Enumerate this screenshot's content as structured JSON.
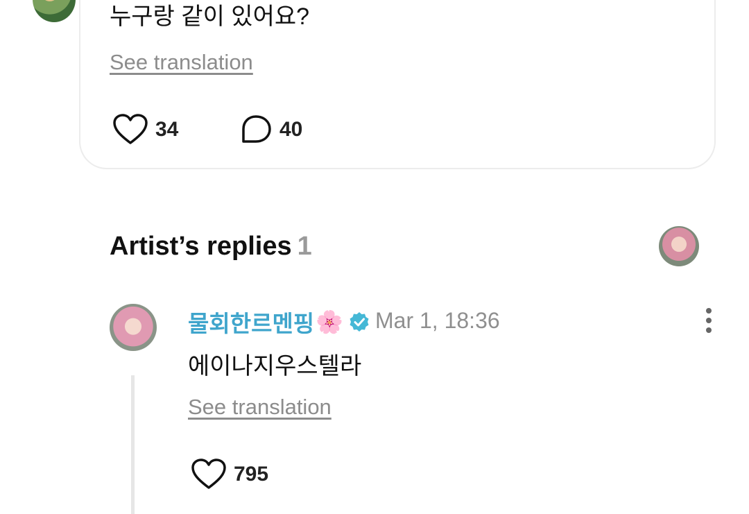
{
  "post": {
    "text": "누구랑 같이 있어요?",
    "see_translation": "See translation",
    "like_count": "34",
    "comment_count": "40"
  },
  "artist_replies": {
    "title": "Artist’s replies",
    "count": "1"
  },
  "reply": {
    "author": "물회한르멘핑",
    "author_emoji": "🌸",
    "timestamp": "Mar 1, 18:36",
    "text": "에이나지우스텔라",
    "see_translation": "See translation",
    "like_count": "795"
  },
  "colors": {
    "author_name": "#3fa5cc",
    "verified_badge": "#45b8d6",
    "muted_text": "#8c8c8c"
  },
  "icons": [
    "heart-icon",
    "comment-bubble-icon",
    "verified-badge-icon",
    "more-vertical-icon"
  ]
}
